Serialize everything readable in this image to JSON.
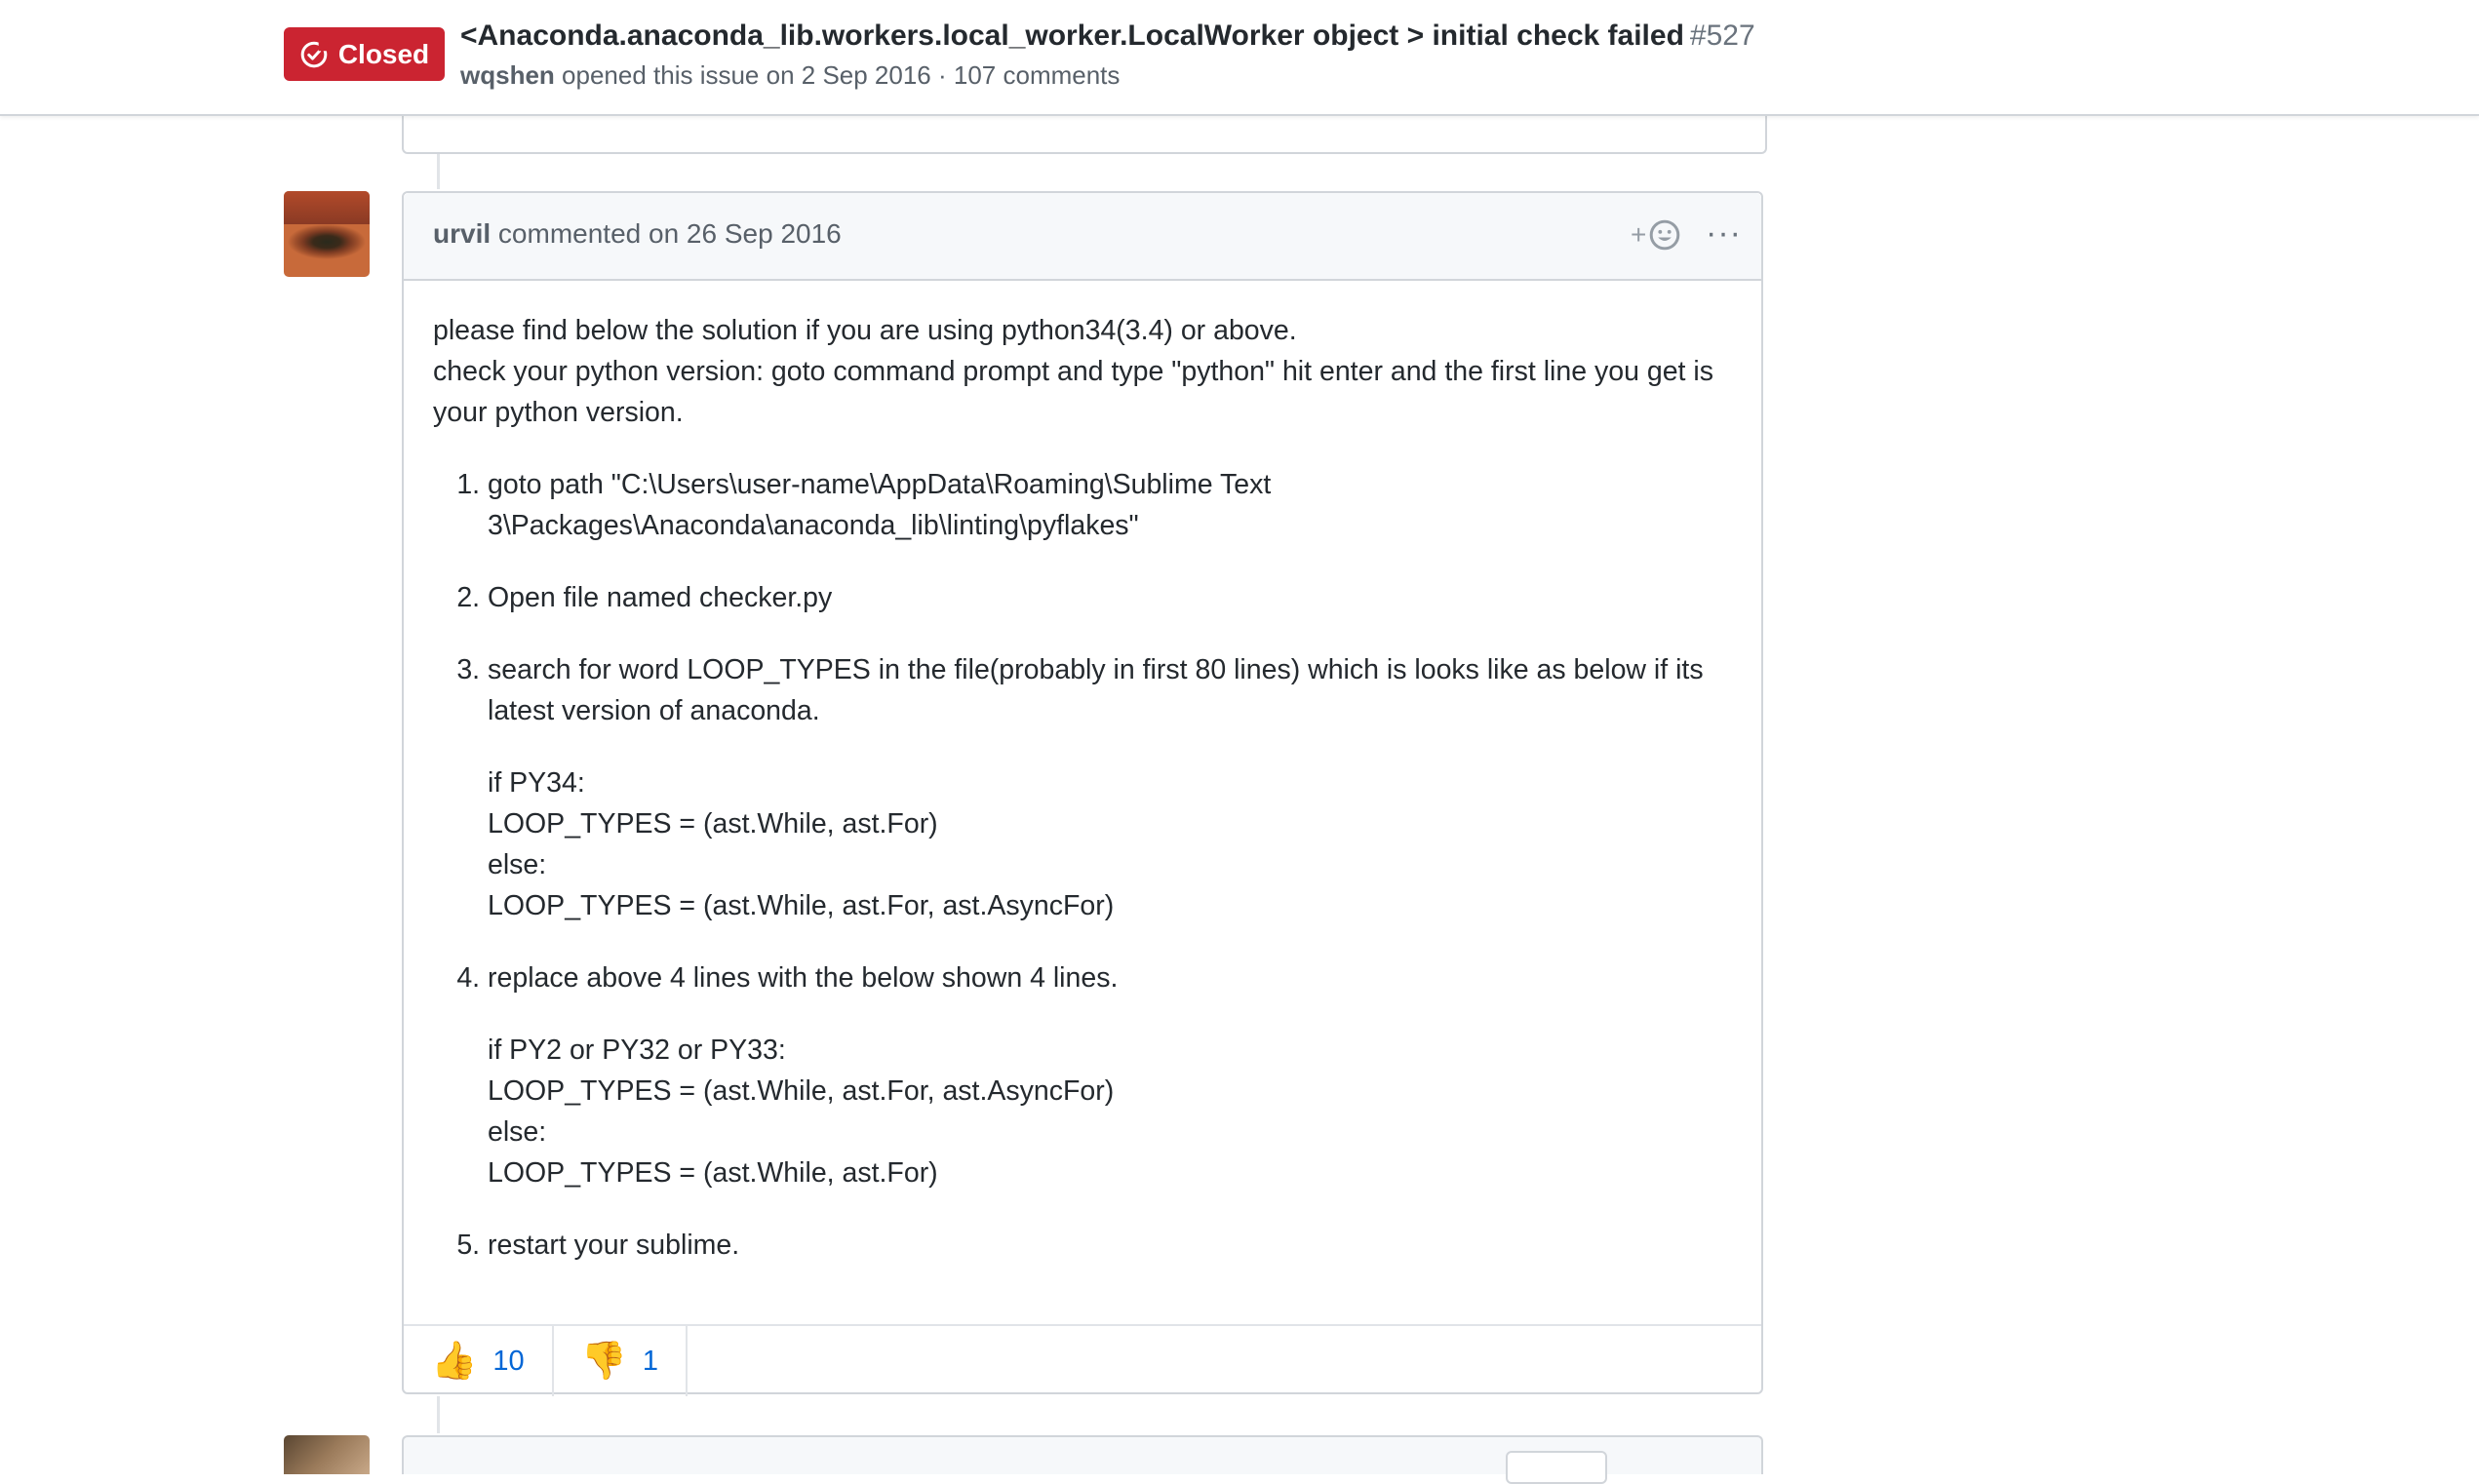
{
  "issue": {
    "status": "Closed",
    "title": "<Anaconda.anaconda_lib.workers.local_worker.LocalWorker object > initial check failed",
    "number": "#527",
    "author": "wqshen",
    "meta": "opened this issue on 2 Sep 2016 · 107 comments"
  },
  "comment": {
    "author": "urvil",
    "when": "commented on 26 Sep 2016",
    "add_reaction": "+",
    "intro": [
      "please find below the solution if you are using python34(3.4) or above.",
      "check your python version: goto command prompt and type \"python\" hit enter and the first line you get is your python version."
    ],
    "steps": [
      {
        "text": "goto path \"C:\\Users\\user-name\\AppData\\Roaming\\Sublime Text 3\\Packages\\Anaconda\\anaconda_lib\\linting\\pyflakes\"",
        "code": []
      },
      {
        "text": "Open file named checker.py",
        "code": []
      },
      {
        "text": "search for word LOOP_TYPES in the file(probably in first 80 lines) which is looks like as below if its latest version of anaconda.",
        "code": [
          "if PY34:",
          "LOOP_TYPES = (ast.While, ast.For)",
          "else:",
          "LOOP_TYPES = (ast.While, ast.For, ast.AsyncFor)"
        ]
      },
      {
        "text": "replace above 4 lines with the below shown 4 lines.",
        "code": [
          "if PY2 or PY32 or PY33:",
          "LOOP_TYPES = (ast.While, ast.For, ast.AsyncFor)",
          "else:",
          "LOOP_TYPES = (ast.While, ast.For)"
        ]
      },
      {
        "text": "restart your sublime.",
        "code": []
      }
    ],
    "reactions": [
      {
        "emoji": "👍",
        "icon": "thumbs-up-icon",
        "count": "10"
      },
      {
        "emoji": "👎",
        "icon": "thumbs-down-icon",
        "count": "1"
      }
    ]
  }
}
